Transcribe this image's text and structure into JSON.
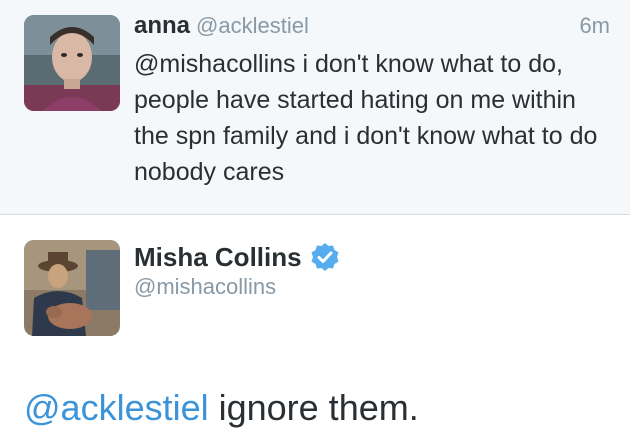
{
  "reply": {
    "name": "anna",
    "handle": "@acklestiel",
    "time": "6m",
    "text": "@mishacollins i don't know what to do, people have started hating on me within the spn family and i don't know what to do nobody cares"
  },
  "tweet": {
    "name": "Misha Collins",
    "handle": "@mishacollins",
    "verified_icon": "verified-badge-icon",
    "mention": "@acklestiel",
    "text": " ignore them."
  },
  "colors": {
    "link": "#3b94d9",
    "muted": "#8899a6",
    "verified": "#55acee"
  }
}
